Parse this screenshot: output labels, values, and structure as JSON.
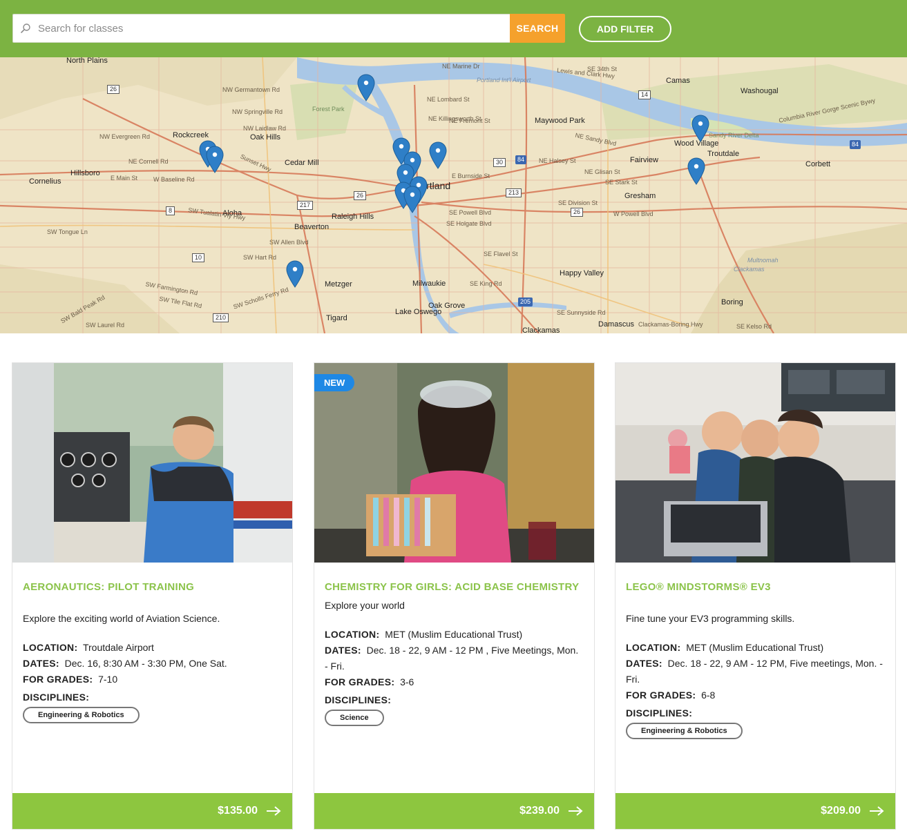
{
  "search": {
    "placeholder": "Search for classes",
    "button_label": "SEARCH"
  },
  "filter": {
    "button_label": "ADD FILTER"
  },
  "colors": {
    "header_green": "#7cb342",
    "search_orange": "#f5a12c",
    "title_green": "#8bc34a",
    "price_green": "#8dc63f",
    "badge_blue": "#1e88e5",
    "pin_blue": "#2f7fc7"
  },
  "map": {
    "labels": {
      "north_plains": "North Plains",
      "rockcreek": "Rockcreek",
      "oak_hills": "Oak Hills",
      "cedar_mill": "Cedar Mill",
      "forest_park": "Forest Park",
      "hillsboro": "Hillsboro",
      "cornelius": "Cornelius",
      "aloha": "Aloha",
      "beaverton": "Beaverton",
      "raleigh_hills": "Raleigh Hills",
      "portland": "Portland",
      "metzger": "Metzger",
      "tigard": "Tigard",
      "lake_oswego": "Lake Oswego",
      "oak_grove": "Oak Grove",
      "milwaukie": "Milwaukie",
      "happy_valley": "Happy Valley",
      "clackamas": "Clackamas",
      "damascus": "Damascus",
      "gresham": "Gresham",
      "fairview": "Fairview",
      "wood_village": "Wood Village",
      "troutdale": "Troutdale",
      "corbett": "Corbett",
      "camas": "Camas",
      "washougal": "Washougal",
      "maywood_park": "Maywood Park",
      "boring": "Boring",
      "airport": "Portland Int'l Airport",
      "sandy_delta": "Sandy River Delta",
      "multnomah": "Multnomah",
      "clackamas_county": "Clackamas",
      "river_columbia": "Columbia River Gorge Scenic Bywy",
      "r_ne_marine": "NE Marine Dr",
      "r_ne_lombard": "NE Lombard St",
      "r_ne_killingsworth": "NE Killingsworth St",
      "r_ne_fremont": "NE Fremont St",
      "r_ne_halsey": "NE Halsey St",
      "r_ne_glisan": "NE Glisan St",
      "r_se_stark": "SE Stark St",
      "r_se_division": "SE Division St",
      "r_se_powell": "SE Powell Blvd",
      "r_se_holgate": "SE Holgate Blvd",
      "r_se_flavel": "SE Flavel St",
      "r_se_king": "SE King Rd",
      "r_se_burnside": "E Burnside St",
      "r_sw_tualatin": "SW Tualatin Vly Hwy",
      "r_sunset": "Sunset Hwy",
      "r_nw_cornell": "NE Cornell Rd",
      "r_nw_germantown": "NW Germantown Rd",
      "r_nw_springville": "NW Springville Rd",
      "r_nw_laidlaw": "NW Laidlaw Rd",
      "r_baseline": "W Baseline Rd",
      "r_sw_farmington": "SW Farmington Rd",
      "r_sw_scholls": "SW Scholls Ferry Rd",
      "r_sw_allen": "SW Allen Blvd",
      "r_sw_hart": "SW Hart Rd",
      "r_sw_tile_flat": "SW Tile Flat Rd",
      "r_se_sunnyside": "SE Sunnyside Rd",
      "r_se_kelso": "SE Kelso Rd",
      "r_lewis_clark": "Lewis and Clark Hwy",
      "r_se34": "SE 34th St",
      "r_powell_w": "W Powell Blvd",
      "r_clackamas_boring": "Clackamas-Boring Hwy",
      "r_e_main": "E Main St",
      "r_nw_evergreen": "NW Evergreen Rd",
      "r_sw_tongue": "SW Tongue Ln",
      "r_sw_laurel": "SW Laurel Rd",
      "r_sw_bald_peak": "SW Bald Peak Rd",
      "r_ne_sandy": "NE Sandy Blvd",
      "r_i84": "84",
      "r_i205": "205",
      "r_26": "26",
      "r_217": "217",
      "r_30": "30",
      "r_14": "14",
      "r_213": "213",
      "r_10": "10",
      "r_210": "210",
      "r_8": "8"
    }
  },
  "classes": [
    {
      "title": "AERONAUTICS: PILOT TRAINING",
      "description": "Explore the exciting world of Aviation Science.",
      "is_new": false,
      "location_label": "LOCATION:",
      "location": "Troutdale Airport",
      "dates_label": "DATES:",
      "dates": "Dec. 16, 8:30 AM - 3:30 PM, One Sat.",
      "grades_label": "FOR GRADES:",
      "grades": "7-10",
      "disciplines_label": "DISCIPLINES:",
      "disciplines": [
        "Engineering & Robotics"
      ],
      "price": "$135.00"
    },
    {
      "title": "CHEMISTRY FOR GIRLS: ACID BASE CHEMISTRY",
      "description": "Explore your world",
      "is_new": true,
      "badge": "NEW",
      "location_label": "LOCATION:",
      "location": "MET (Muslim Educational Trust)",
      "dates_label": "DATES:",
      "dates": "Dec. 18 - 22, 9 AM - 12 PM , Five Meetings, Mon. - Fri.",
      "grades_label": "FOR GRADES:",
      "grades": "3-6",
      "disciplines_label": "DISCIPLINES:",
      "disciplines": [
        "Science"
      ],
      "price": "$239.00"
    },
    {
      "title": "LEGO® MINDSTORMS® EV3",
      "description": "Fine tune your EV3 programming skills.",
      "is_new": false,
      "location_label": "LOCATION:",
      "location": "MET (Muslim Educational Trust)",
      "dates_label": "DATES:",
      "dates": "Dec. 18 - 22, 9 AM - 12 PM, Five meetings, Mon. - Fri.",
      "grades_label": "FOR GRADES:",
      "grades": "6-8",
      "disciplines_label": "DISCIPLINES:",
      "disciplines": [
        "Engineering & Robotics"
      ],
      "price": "$209.00"
    }
  ]
}
